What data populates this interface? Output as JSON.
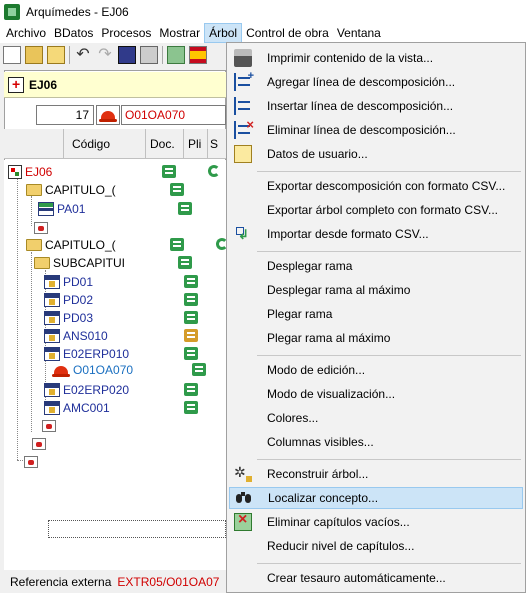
{
  "window": {
    "title": "Arquímedes - EJ06"
  },
  "menubar": {
    "items": [
      {
        "label": "Archivo"
      },
      {
        "label": "BDatos"
      },
      {
        "label": "Procesos"
      },
      {
        "label": "Mostrar"
      },
      {
        "label": "Árbol"
      },
      {
        "label": "Control de obra"
      },
      {
        "label": "Ventana"
      }
    ],
    "active_index": 4
  },
  "toolbar": {
    "buttons": [
      "new-file",
      "open-folder",
      "new-folder",
      "undo",
      "redo",
      "save",
      "print",
      "tool",
      "spain-flag"
    ]
  },
  "panel": {
    "tab_label": "EJ06",
    "quantity_value": "17",
    "code_value": "O01OA070"
  },
  "columns": [
    "Código",
    "Doc.",
    "Pli",
    "S"
  ],
  "tree": {
    "rows": [
      {
        "label": "EJ06",
        "color": "#d00000"
      },
      {
        "label": "CAPITULO_(",
        "color": "#000000"
      },
      {
        "label": "PA01",
        "color": "#1f2f9a"
      },
      {
        "label": "",
        "color": "#000000"
      },
      {
        "label": "CAPITULO_(",
        "color": "#000000"
      },
      {
        "label": "SUBCAPITUI",
        "color": "#000000"
      },
      {
        "label": "PD01",
        "color": "#1f2f9a"
      },
      {
        "label": "PD02",
        "color": "#1f2f9a"
      },
      {
        "label": "PD03",
        "color": "#1f2f9a"
      },
      {
        "label": "ANS010",
        "color": "#1f2f9a"
      },
      {
        "label": "E02ERP010",
        "color": "#1f2f9a"
      },
      {
        "label": "O01OA070",
        "color": "#1a6fc0"
      },
      {
        "label": "E02ERP020",
        "color": "#1f2f9a"
      },
      {
        "label": "AMC001",
        "color": "#1f2f9a"
      }
    ]
  },
  "status": {
    "label": "Referencia externa",
    "value": "EXTR05/O01OA07"
  },
  "context_menu": {
    "items": [
      {
        "label": "Imprimir contenido de la vista...",
        "icon": "printer-icon"
      },
      {
        "label": "Agregar línea de descomposición...",
        "icon": "tree-add-icon"
      },
      {
        "label": "Insertar línea de descomposición...",
        "icon": "tree-insert-icon"
      },
      {
        "label": "Eliminar línea de descomposición...",
        "icon": "tree-delete-icon"
      },
      {
        "label": "Datos de usuario...",
        "icon": "user-data-icon"
      },
      {
        "label": "Exportar descomposición con formato CSV...",
        "icon": ""
      },
      {
        "label": "Exportar árbol completo con formato CSV...",
        "icon": ""
      },
      {
        "label": "Importar desde formato CSV...",
        "icon": "import-icon"
      },
      {
        "label": "Desplegar rama",
        "icon": ""
      },
      {
        "label": "Desplegar rama al máximo",
        "icon": ""
      },
      {
        "label": "Plegar rama",
        "icon": ""
      },
      {
        "label": "Plegar rama al máximo",
        "icon": ""
      },
      {
        "label": "Modo de edición...",
        "icon": ""
      },
      {
        "label": "Modo de visualización...",
        "icon": ""
      },
      {
        "label": "Colores...",
        "icon": ""
      },
      {
        "label": "Columnas visibles...",
        "icon": ""
      },
      {
        "label": "Reconstruir árbol...",
        "icon": "gears-icon"
      },
      {
        "label": "Localizar concepto...",
        "icon": "binoculars-icon"
      },
      {
        "label": "Eliminar capítulos vacíos...",
        "icon": "delete-chapters-icon"
      },
      {
        "label": "Reducir nivel de capítulos...",
        "icon": ""
      },
      {
        "label": "Crear tesauro automáticamente...",
        "icon": ""
      }
    ],
    "highlighted_index": 17
  }
}
